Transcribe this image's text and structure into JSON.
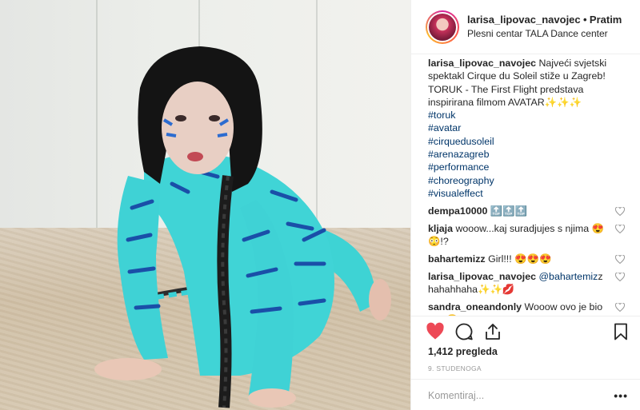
{
  "header": {
    "username": "larisa_lipovac_navojec",
    "separator": "•",
    "follow_label": "Pratim",
    "location": "Plesni centar TALA Dance center"
  },
  "caption": {
    "username": "larisa_lipovac_navojec",
    "text": "Najveći svjetski spektakl Cirque du Soleil stiže u Zagreb! TORUK - The First Flight predstava inspirirana filmom AVATAR✨✨✨",
    "hashtags": [
      "#toruk",
      "#avatar",
      "#cirquedusoleil",
      "#arenazagreb",
      "#performance",
      "#choreography",
      "#visualeffect"
    ]
  },
  "comments": [
    {
      "username": "dempa10000",
      "text": "🔝🔝🔝"
    },
    {
      "username": "kljaja",
      "text": "wooow...kaj suradjujes s njima 😍😳!?"
    },
    {
      "username": "bahartemizz",
      "text": "Girl!!! 😍😍😍"
    },
    {
      "username": "larisa_lipovac_navojec",
      "mention": "@bahartemiz",
      "text": "z hahahhaha✨✨💋"
    },
    {
      "username": "sandra_oneandonly",
      "text": "Wooow ovo je bio šok 😳"
    }
  ],
  "stats": {
    "views": "1,412 pregleda",
    "date": "9. STUDENOGA"
  },
  "comment_box": {
    "placeholder": "Komentiraj...",
    "more_label": "•••"
  },
  "icons": {
    "like": "heart-filled-icon",
    "comment": "comment-bubble-icon",
    "share": "share-upload-icon",
    "save": "bookmark-icon",
    "like_color": "#ed4956"
  }
}
